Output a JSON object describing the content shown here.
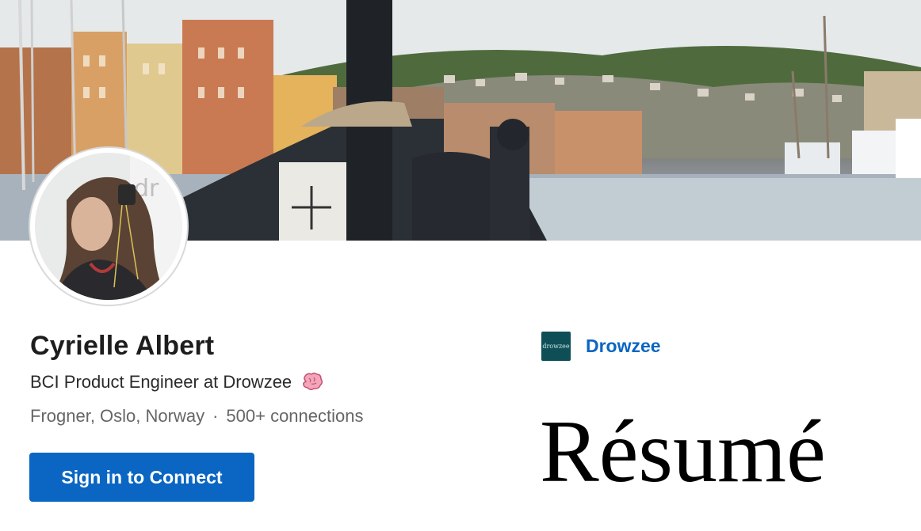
{
  "profile": {
    "name": "Cyrielle Albert",
    "headline": "BCI Product Engineer at Drowzee",
    "headline_icon": "brain-icon",
    "location": "Frogner, Oslo, Norway",
    "separator": "·",
    "connections": "500+ connections"
  },
  "actions": {
    "connect_label": "Sign in to Connect"
  },
  "company": {
    "logo_text": "drowzee",
    "name": "Drowzee"
  },
  "resume_label": "Résumé",
  "colors": {
    "primary": "#0a66c2",
    "company_logo_bg": "#0e4f57"
  }
}
